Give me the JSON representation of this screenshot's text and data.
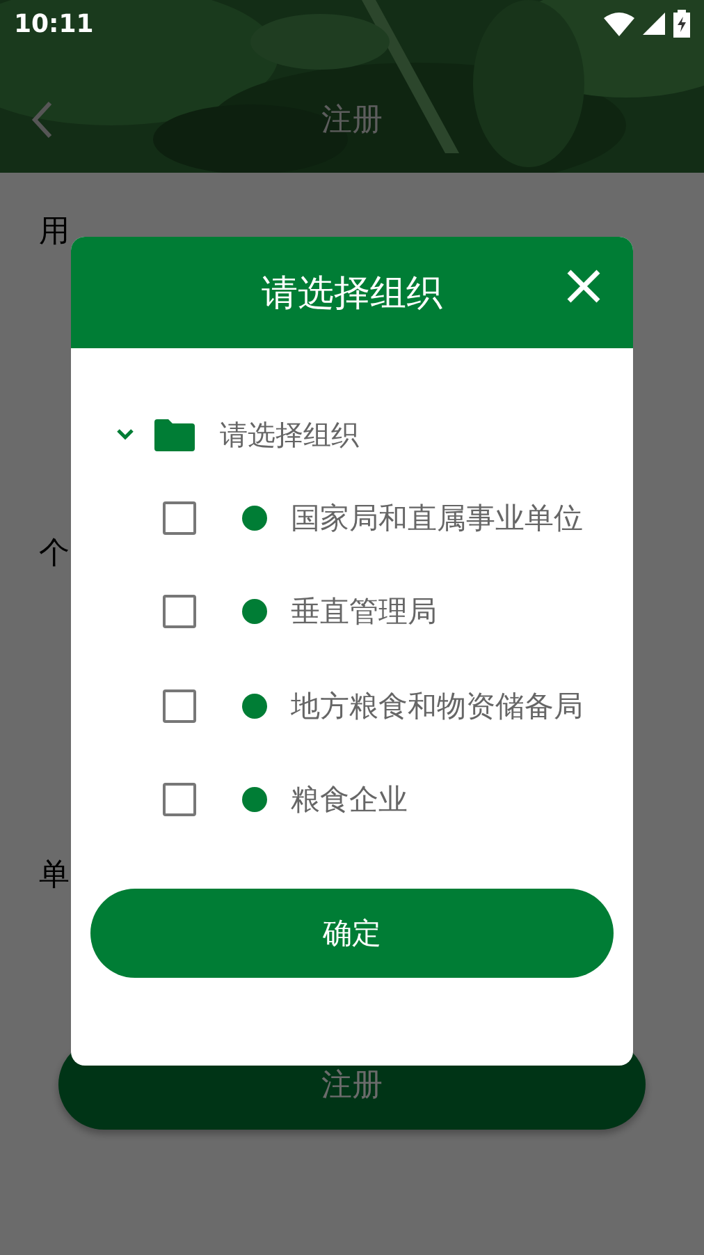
{
  "status_bar": {
    "time": "10:11"
  },
  "header": {
    "title": "注册"
  },
  "form": {
    "sections": [
      {
        "label": "用"
      },
      {
        "label": "个"
      },
      {
        "label": "单"
      }
    ],
    "submit": "注册"
  },
  "dialog": {
    "title": "请选择组织",
    "tree": {
      "label": "请选择组织",
      "expanded": true,
      "children": [
        {
          "label": "国家局和直属事业单位",
          "checked": false,
          "color": "#007d35"
        },
        {
          "label": "垂直管理局",
          "checked": false,
          "color": "#007d35"
        },
        {
          "label": "地方粮食和物资储备局",
          "checked": false,
          "color": "#007d35"
        },
        {
          "label": "粮食企业",
          "checked": false,
          "color": "#007d35"
        }
      ]
    },
    "confirm": "确定"
  }
}
